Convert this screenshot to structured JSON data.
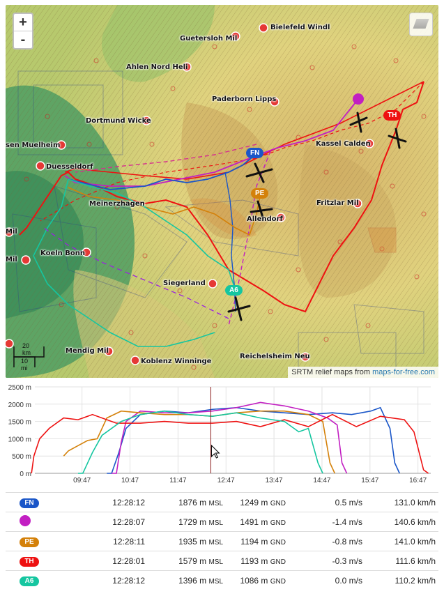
{
  "map": {
    "zoom_in": "+",
    "zoom_out": "-",
    "attribution_text": "SRTM relief maps from ",
    "attribution_link": "maps-for-free.com",
    "scale_km": "20 km",
    "scale_mi": "10 mi",
    "places": [
      {
        "name": "Bielefeld Windl"
      },
      {
        "name": "Guetersloh Mil"
      },
      {
        "name": "Ahlen Nord Heli"
      },
      {
        "name": "Paderborn Lipps"
      },
      {
        "name": "Dortmund Wicke"
      },
      {
        "name": "Kassel Calden"
      },
      {
        "name": "sen Muelheim"
      },
      {
        "name": "Duesseldorf"
      },
      {
        "name": "Meinerzhagen"
      },
      {
        "name": "Allendorf"
      },
      {
        "name": "Fritzlar Mil"
      },
      {
        "name": "Koeln Bonn"
      },
      {
        "name": "Siegerland"
      },
      {
        "name": "Mendig Mil"
      },
      {
        "name": "Koblenz Winninge"
      },
      {
        "name": "Reichelsheim Neu"
      },
      {
        "name": "Mil"
      },
      {
        "name": "Mil"
      }
    ],
    "tags": [
      {
        "label": "FN",
        "color": "#1a56c8"
      },
      {
        "label": "PE",
        "color": "#d4810a"
      },
      {
        "label": "TH",
        "color": "#ee1111"
      },
      {
        "label": "A6",
        "color": "#15c6a0"
      }
    ]
  },
  "chart_data": {
    "type": "line",
    "x_ticks": [
      "09:47",
      "10:47",
      "11:47",
      "12:47",
      "13:47",
      "14:47",
      "15:47",
      "16:47"
    ],
    "y_ticks": [
      "0 m",
      "500 m",
      "1000 m",
      "1500 m",
      "2000 m",
      "2500 m"
    ],
    "ylim": [
      0,
      2500
    ],
    "cursor_time": "12:28",
    "series": [
      {
        "name": "FN",
        "color": "#1a56c8",
        "x": [
          10.3,
          10.4,
          10.55,
          10.7,
          11.0,
          11.5,
          12.0,
          12.5,
          13.0,
          13.5,
          14.0,
          14.5,
          15.0,
          15.4,
          15.8,
          16.0,
          16.2,
          16.3,
          16.4
        ],
        "y": [
          0,
          0,
          600,
          1300,
          1700,
          1800,
          1750,
          1850,
          1900,
          1800,
          1750,
          1700,
          1750,
          1700,
          1800,
          1900,
          1300,
          300,
          0
        ]
      },
      {
        "name": "Purple",
        "color": "#c21fc2",
        "x": [
          10.4,
          10.5,
          10.6,
          10.7,
          11.0,
          11.5,
          12.0,
          12.5,
          13.0,
          13.5,
          14.0,
          14.5,
          14.9,
          15.1,
          15.2,
          15.3
        ],
        "y": [
          0,
          0,
          900,
          1500,
          1800,
          1750,
          1750,
          1800,
          1900,
          2050,
          1950,
          1800,
          1600,
          1400,
          300,
          0
        ]
      },
      {
        "name": "PE",
        "color": "#d4810a",
        "x": [
          9.4,
          9.5,
          9.7,
          9.9,
          10.1,
          10.3,
          10.6,
          11.0,
          11.5,
          12.0,
          12.5,
          13.0,
          13.5,
          14.0,
          14.5,
          14.8,
          14.95,
          15.05
        ],
        "y": [
          500,
          650,
          800,
          950,
          1000,
          1600,
          1800,
          1750,
          1700,
          1700,
          1650,
          1750,
          1800,
          1800,
          1700,
          1500,
          300,
          0
        ]
      },
      {
        "name": "TH",
        "color": "#ee1111",
        "x": [
          8.73,
          8.78,
          8.9,
          9.1,
          9.4,
          9.7,
          10.0,
          10.5,
          11.0,
          11.5,
          12.0,
          12.5,
          13.0,
          13.5,
          14.0,
          14.5,
          15.0,
          15.5,
          16.0,
          16.5,
          16.7,
          16.9,
          17.0
        ],
        "y": [
          0,
          500,
          1000,
          1300,
          1600,
          1550,
          1700,
          1450,
          1450,
          1500,
          1450,
          1450,
          1500,
          1350,
          1550,
          1350,
          1700,
          1350,
          1650,
          1550,
          1200,
          100,
          0
        ]
      },
      {
        "name": "A6",
        "color": "#15c6a0",
        "x": [
          9.7,
          9.8,
          10.0,
          10.2,
          10.6,
          11.0,
          11.5,
          12.0,
          12.5,
          13.0,
          13.5,
          14.0,
          14.3,
          14.5,
          14.7,
          14.8
        ],
        "y": [
          0,
          0,
          600,
          1100,
          1500,
          1700,
          1800,
          1700,
          1650,
          1750,
          1600,
          1500,
          1200,
          1300,
          300,
          0
        ]
      }
    ]
  },
  "table": {
    "rows": [
      {
        "label": "FN",
        "color": "#1a56c8",
        "type": "pill",
        "time": "12:28:12",
        "msl": "1876 m",
        "msl_unit": "MSL",
        "gnd": "1249 m",
        "gnd_unit": "GND",
        "vario": "0.5 m/s",
        "speed": "131.0 km/h"
      },
      {
        "label": "",
        "color": "#c21fc2",
        "type": "dot",
        "time": "12:28:07",
        "msl": "1729 m",
        "msl_unit": "MSL",
        "gnd": "1491 m",
        "gnd_unit": "GND",
        "vario": "-1.4 m/s",
        "speed": "140.6 km/h"
      },
      {
        "label": "PE",
        "color": "#d4810a",
        "type": "pill",
        "time": "12:28:11",
        "msl": "1935 m",
        "msl_unit": "MSL",
        "gnd": "1194 m",
        "gnd_unit": "GND",
        "vario": "-0.8 m/s",
        "speed": "141.0 km/h"
      },
      {
        "label": "TH",
        "color": "#ee1111",
        "type": "pill",
        "time": "12:28:01",
        "msl": "1579 m",
        "msl_unit": "MSL",
        "gnd": "1193 m",
        "gnd_unit": "GND",
        "vario": "-0.3 m/s",
        "speed": "111.6 km/h"
      },
      {
        "label": "A6",
        "color": "#15c6a0",
        "type": "pill",
        "time": "12:28:12",
        "msl": "1396 m",
        "msl_unit": "MSL",
        "gnd": "1086 m",
        "gnd_unit": "GND",
        "vario": "0.0 m/s",
        "speed": "110.2 km/h"
      }
    ]
  }
}
